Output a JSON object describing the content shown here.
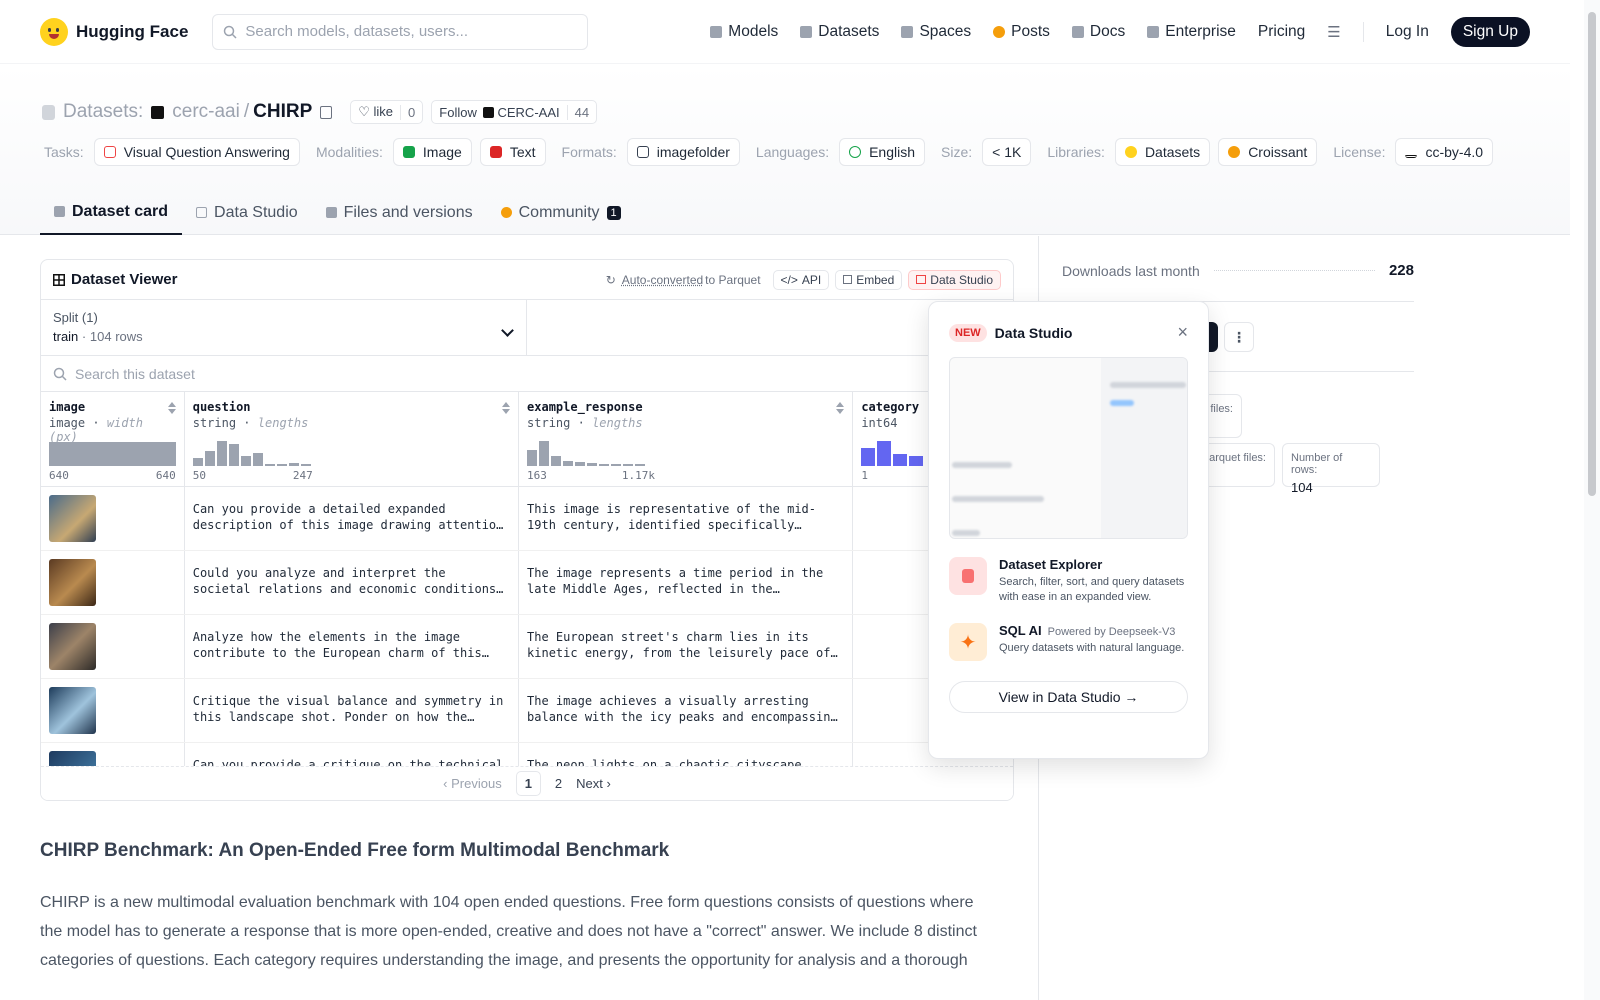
{
  "nav": {
    "brand": "Hugging Face",
    "search_placeholder": "Search models, datasets, users...",
    "links": [
      "Models",
      "Datasets",
      "Spaces",
      "Posts",
      "Docs",
      "Enterprise"
    ],
    "pricing": "Pricing",
    "login": "Log In",
    "signup": "Sign Up"
  },
  "header": {
    "section": "Datasets:",
    "owner": "cerc-aai",
    "slash": "/",
    "name": "CHIRP",
    "like_label": "like",
    "like_count": "0",
    "follow_label": "Follow",
    "follow_org": "CERC-AAI",
    "follow_count": "44"
  },
  "tags": {
    "tasks_label": "Tasks:",
    "task": "Visual Question Answering",
    "modalities_label": "Modalities:",
    "modality_1": "Image",
    "modality_2": "Text",
    "formats_label": "Formats:",
    "format": "imagefolder",
    "languages_label": "Languages:",
    "language": "English",
    "size_label": "Size:",
    "size": "< 1K",
    "libraries_label": "Libraries:",
    "library_1": "Datasets",
    "library_2": "Croissant",
    "license_label": "License:",
    "license": "cc-by-4.0"
  },
  "tabs": {
    "card": "Dataset card",
    "studio": "Data Studio",
    "files": "Files and versions",
    "community": "Community",
    "community_count": "1"
  },
  "viewer": {
    "title": "Dataset Viewer",
    "auto_converted": "Auto-converted",
    "to_parquet": "to Parquet",
    "api": "API",
    "embed": "Embed",
    "data_studio": "Data Studio",
    "split_label": "Split (1)",
    "split_name": "train",
    "split_dot": "·",
    "split_rows": "104 rows",
    "search_placeholder": "Search this dataset",
    "columns": [
      {
        "name": "image",
        "type": "image",
        "stat": "width (px)",
        "min": "640",
        "max": "640"
      },
      {
        "name": "question",
        "type": "string",
        "stat": "lengths",
        "min": "50",
        "max": "247"
      },
      {
        "name": "example_response",
        "type": "string",
        "stat": "lengths",
        "min": "163",
        "max": "1.17k"
      },
      {
        "name": "category",
        "type": "int64",
        "stat": "",
        "min": "1",
        "max": ""
      }
    ],
    "rows": [
      {
        "question": "Can you provide a detailed expanded description of this image drawing attention to the key visual elements?",
        "response": "This image is representative of the mid-19th century, identified specifically through the clothing and architecture."
      },
      {
        "question": "Could you analyze and interpret the societal relations and economic conditions reflected in this image?",
        "response": "The image represents a time period in the late Middle Ages, reflected in the colourful marketplace scene."
      },
      {
        "question": "Analyze how the elements in the image contribute to the European charm of this busy street.",
        "response": "The European street's charm lies in its kinetic energy, from the leisurely pace of the pedestrians."
      },
      {
        "question": "Critique the visual balance and symmetry in this landscape shot. Ponder on how the composition works.",
        "response": "The image achieves a visually arresting balance with the icy peaks and encompassing clouds."
      },
      {
        "question": "Can you provide a critique on the technical aspects of this photograph?",
        "response": "The neon lights on a chaotic cityscape creates a vibrant mood."
      }
    ],
    "pager": {
      "prev": "Previous",
      "p1": "1",
      "p2": "2",
      "next": "Next"
    }
  },
  "popover": {
    "badge": "NEW",
    "title": "Data Studio",
    "close": "×",
    "f1_title": "Dataset Explorer",
    "f1_desc": "Search, filter, sort, and query datasets with ease in an expanded view.",
    "f2_title": "SQL AI",
    "f2_powered": "Powered by Deepseek-V3",
    "f2_desc": "Query datasets with natural language.",
    "button": "View in Data Studio →"
  },
  "sidebar": {
    "downloads_label": "Downloads last month",
    "downloads": "228",
    "stat1_label": "files:",
    "stat2_label": "arquet files:",
    "stat3_label": "Number of rows:",
    "stat3_value": "104"
  },
  "content": {
    "heading": "CHIRP Benchmark: An Open-Ended Free form Multimodal Benchmark",
    "paragraph": "CHIRP is a new multimodal evaluation benchmark with 104 open ended questions. Free form questions consists of questions where the model has to generate a response that is more open-ended, creative and does not have a \"correct\" answer. We include 8 distinct categories of questions. Each category requires understanding the image, and presents the opportunity for analysis and a thorough"
  },
  "colors": {
    "signup_bg": "#0b1124",
    "logo_yellow": "#ffd21e",
    "hist_blue": "#6366f1",
    "new_badge": "#dc2626"
  }
}
